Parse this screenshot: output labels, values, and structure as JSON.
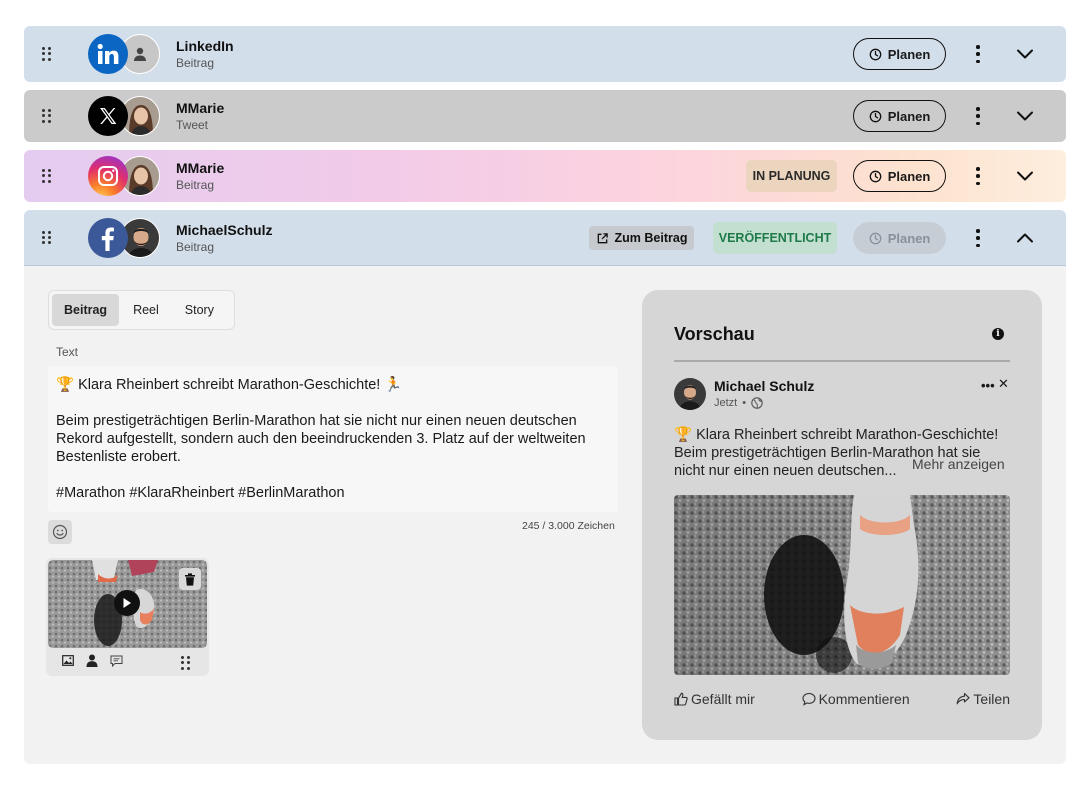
{
  "accounts": [
    {
      "network": "LinkedIn",
      "name": "LinkedIn",
      "type": "Beitrag",
      "plan_label": "Planen"
    },
    {
      "network": "X",
      "name": "MMarie",
      "type": "Tweet",
      "plan_label": "Planen"
    },
    {
      "network": "Instagram",
      "name": "MMarie",
      "type": "Beitrag",
      "status": "IN PLANUNG",
      "plan_label": "Planen"
    },
    {
      "network": "Facebook",
      "name": "MichaelSchulz",
      "type": "Beitrag",
      "status": "VERÖFFENTLICHT",
      "open_post_label": "Zum Beitrag",
      "plan_label": "Planen",
      "plan_disabled": true,
      "expanded": true
    }
  ],
  "editor": {
    "tabs": [
      "Beitrag",
      "Reel",
      "Story"
    ],
    "active_tab": "Beitrag",
    "text_label": "Text",
    "text": "🏆 Klara Rheinbert schreibt Marathon-Geschichte! 🏃\n\nBeim prestigeträchtigen Berlin-Marathon hat sie nicht nur einen neuen deutschen Rekord aufgestellt, sondern auch den beeindruckenden 3. Platz auf der weltweiten Bestenliste erobert.\n\n#Marathon #KlaraRheinbert #BerlinMarathon",
    "char_count": "245 / 3.000 Zeichen"
  },
  "preview": {
    "title": "Vorschau",
    "author": "Michael Schulz",
    "time": "Jetzt",
    "separator": "•",
    "text": "🏆 Klara Rheinbert schreibt Marathon-Geschichte! Beim prestigeträchtigen Berlin-Marathon hat sie nicht nur einen neuen deutschen...",
    "show_more": "Mehr anzeigen",
    "actions": {
      "like": "Gefällt mir",
      "comment": "Kommentieren",
      "share": "Teilen"
    }
  },
  "colors": {
    "linkedin": "#0a66c2",
    "facebook": "#3b5998",
    "published": "#1e7a48",
    "row_blue": "#d3deeb"
  }
}
